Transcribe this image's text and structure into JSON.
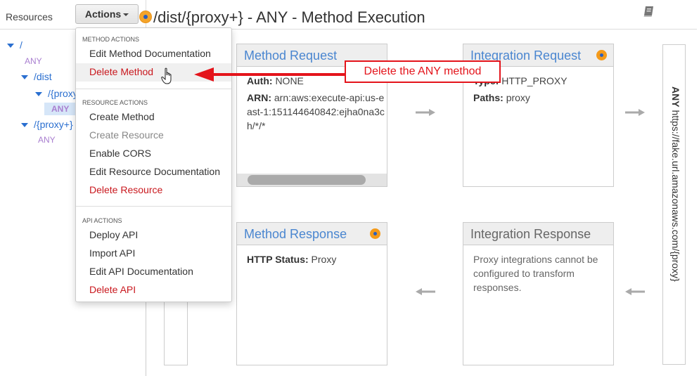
{
  "sidebar": {
    "resources_label": "Resources",
    "actions_label": "Actions",
    "tree": [
      {
        "path": "/",
        "method": "ANY"
      },
      {
        "path": "/dist"
      },
      {
        "path": "/{proxy+}",
        "method": "ANY",
        "selected": true
      },
      {
        "path": "/{proxy+}",
        "method": "ANY"
      }
    ]
  },
  "header": {
    "title": "/dist/{proxy+} - ANY - Method Execution",
    "doc_icon": "book-icon"
  },
  "dropdown": {
    "sections": [
      {
        "title": "METHOD ACTIONS",
        "items": [
          {
            "label": "Edit Method Documentation",
            "style": "normal"
          },
          {
            "label": "Delete Method",
            "style": "danger",
            "hover": true
          }
        ]
      },
      {
        "title": "RESOURCE ACTIONS",
        "items": [
          {
            "label": "Create Method",
            "style": "normal"
          },
          {
            "label": "Create Resource",
            "style": "disabled"
          },
          {
            "label": "Enable CORS",
            "style": "normal"
          },
          {
            "label": "Edit Resource Documentation",
            "style": "normal"
          },
          {
            "label": "Delete Resource",
            "style": "danger"
          }
        ]
      },
      {
        "title": "API ACTIONS",
        "items": [
          {
            "label": "Deploy API",
            "style": "normal"
          },
          {
            "label": "Import API",
            "style": "normal"
          },
          {
            "label": "Edit API Documentation",
            "style": "normal"
          },
          {
            "label": "Delete API",
            "style": "danger"
          }
        ]
      }
    ]
  },
  "annotation": {
    "text": "Delete the ANY method",
    "color": "#e4141b"
  },
  "method_request": {
    "title": "Method Request",
    "auth_label": "Auth:",
    "auth_value": "NONE",
    "arn_label": "ARN:",
    "arn_value": "arn:aws:execute-api:us-east-1:151144640842:ejha0na3ch/*/*"
  },
  "integration_request": {
    "title": "Integration Request",
    "type_label": "Type:",
    "type_value": "HTTP_PROXY",
    "paths_label": "Paths:",
    "paths_value": "proxy"
  },
  "method_response": {
    "title": "Method Response",
    "status_label": "HTTP Status:",
    "status_value": "Proxy"
  },
  "integration_response": {
    "title": "Integration Response",
    "message": "Proxy integrations cannot be configured to transform responses."
  },
  "endpoint": {
    "method": "ANY",
    "url": "https://fake.url.amazonaws.com/{proxy}"
  },
  "colors": {
    "link_blue": "#4a86d0",
    "danger_red": "#c9181e",
    "method_purple": "#a97fd0",
    "status_orange": "#f49a1a"
  }
}
